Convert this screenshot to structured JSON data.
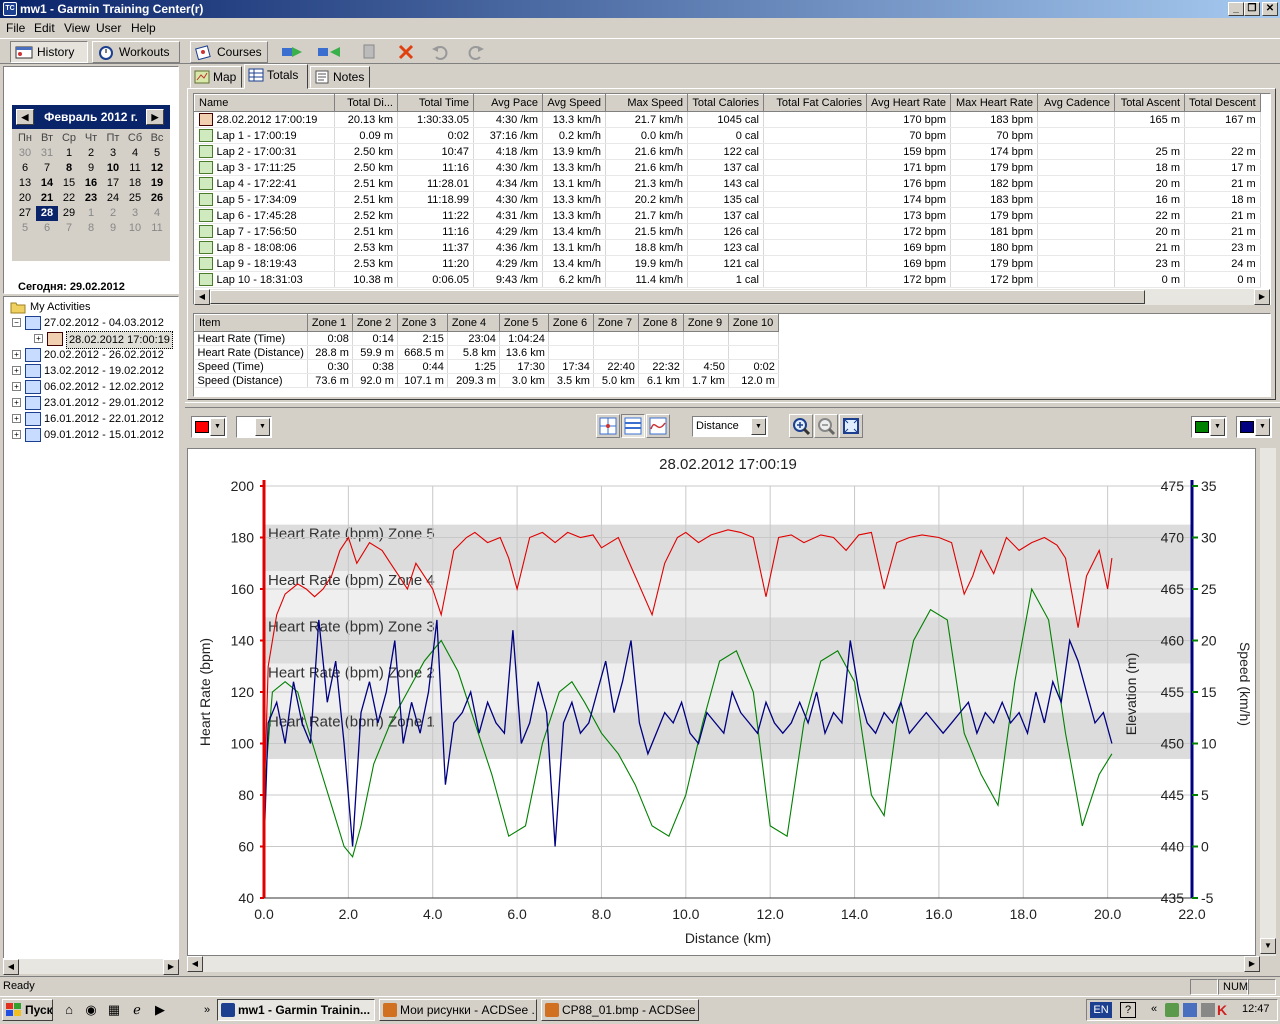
{
  "window": {
    "title": "mw1 - Garmin Training Center(r)",
    "btn_min": "_",
    "btn_max": "❐",
    "btn_close": "✕"
  },
  "menu": [
    "File",
    "Edit",
    "View",
    "User",
    "Help"
  ],
  "toolbar": {
    "history": "History",
    "workouts": "Workouts",
    "courses": "Courses"
  },
  "calendar": {
    "month": "Февраль 2012 г.",
    "prev": "◀",
    "next": "▶",
    "dow": [
      "Пн",
      "Вт",
      "Ср",
      "Чт",
      "Пт",
      "Сб",
      "Вс"
    ],
    "weeks": [
      [
        "30",
        "31",
        "1",
        "2",
        "3",
        "4",
        "5"
      ],
      [
        "6",
        "7",
        "8",
        "9",
        "10",
        "11",
        "12"
      ],
      [
        "13",
        "14",
        "15",
        "16",
        "17",
        "18",
        "19"
      ],
      [
        "20",
        "21",
        "22",
        "23",
        "24",
        "25",
        "26"
      ],
      [
        "27",
        "28",
        "29",
        "1",
        "2",
        "3",
        "4"
      ],
      [
        "5",
        "6",
        "7",
        "8",
        "9",
        "10",
        "11"
      ]
    ],
    "bold_days": [
      "8",
      "10",
      "12",
      "14",
      "16",
      "19",
      "21",
      "23",
      "26",
      "28"
    ],
    "selected_day": "28",
    "today": "Сегодня: 29.02.2012"
  },
  "tree": {
    "root": "My Activities",
    "items": [
      {
        "label": "27.02.2012 - 04.03.2012",
        "expanded": true
      },
      {
        "label": "28.02.2012 17:00:19",
        "child": true,
        "selected": true
      },
      {
        "label": "20.02.2012 - 26.02.2012"
      },
      {
        "label": "13.02.2012 - 19.02.2012"
      },
      {
        "label": "06.02.2012 - 12.02.2012"
      },
      {
        "label": "23.01.2012 - 29.01.2012"
      },
      {
        "label": "16.01.2012 - 22.01.2012"
      },
      {
        "label": "09.01.2012 - 15.01.2012"
      }
    ]
  },
  "tabs": {
    "map": "Map",
    "totals": "Totals",
    "notes": "Notes"
  },
  "laps": {
    "columns": [
      "Name",
      "Total Di...",
      "Total Time",
      "Avg Pace",
      "Avg Speed",
      "Max Speed",
      "Total Calories",
      "Total Fat Calories",
      "Avg Heart Rate",
      "Max Heart Rate",
      "Avg Cadence",
      "Total Ascent",
      "Total Descent"
    ],
    "rows": [
      [
        "28.02.2012 17:00:19",
        "20.13 km",
        "1:30:33.05",
        "4:30 /km",
        "13.3 km/h",
        "21.7 km/h",
        "1045 cal",
        "",
        "170 bpm",
        "183 bpm",
        "",
        "165 m",
        "167 m"
      ],
      [
        "Lap 1 - 17:00:19",
        "0.09 m",
        "0:02",
        "37:16 /km",
        "0.2 km/h",
        "0.0 km/h",
        "0 cal",
        "",
        "70 bpm",
        "70 bpm",
        "",
        "",
        ""
      ],
      [
        "Lap 2 - 17:00:31",
        "2.50 km",
        "10:47",
        "4:18 /km",
        "13.9 km/h",
        "21.6 km/h",
        "122 cal",
        "",
        "159 bpm",
        "174 bpm",
        "",
        "25 m",
        "22 m"
      ],
      [
        "Lap 3 - 17:11:25",
        "2.50 km",
        "11:16",
        "4:30 /km",
        "13.3 km/h",
        "21.6 km/h",
        "137 cal",
        "",
        "171 bpm",
        "179 bpm",
        "",
        "18 m",
        "17 m"
      ],
      [
        "Lap 4 - 17:22:41",
        "2.51 km",
        "11:28.01",
        "4:34 /km",
        "13.1 km/h",
        "21.3 km/h",
        "143 cal",
        "",
        "176 bpm",
        "182 bpm",
        "",
        "20 m",
        "21 m"
      ],
      [
        "Lap 5 - 17:34:09",
        "2.51 km",
        "11:18.99",
        "4:30 /km",
        "13.3 km/h",
        "20.2 km/h",
        "135 cal",
        "",
        "174 bpm",
        "183 bpm",
        "",
        "16 m",
        "18 m"
      ],
      [
        "Lap 6 - 17:45:28",
        "2.52 km",
        "11:22",
        "4:31 /km",
        "13.3 km/h",
        "21.7 km/h",
        "137 cal",
        "",
        "173 bpm",
        "179 bpm",
        "",
        "22 m",
        "21 m"
      ],
      [
        "Lap 7 - 17:56:50",
        "2.51 km",
        "11:16",
        "4:29 /km",
        "13.4 km/h",
        "21.5 km/h",
        "126 cal",
        "",
        "172 bpm",
        "181 bpm",
        "",
        "20 m",
        "21 m"
      ],
      [
        "Lap 8 - 18:08:06",
        "2.53 km",
        "11:37",
        "4:36 /km",
        "13.1 km/h",
        "18.8 km/h",
        "123 cal",
        "",
        "169 bpm",
        "180 bpm",
        "",
        "21 m",
        "23 m"
      ],
      [
        "Lap 9 - 18:19:43",
        "2.53 km",
        "11:20",
        "4:29 /km",
        "13.4 km/h",
        "19.9 km/h",
        "121 cal",
        "",
        "169 bpm",
        "179 bpm",
        "",
        "23 m",
        "24 m"
      ],
      [
        "Lap 10 - 18:31:03",
        "10.38 m",
        "0:06.05",
        "9:43 /km",
        "6.2 km/h",
        "11.4 km/h",
        "1 cal",
        "",
        "172 bpm",
        "172 bpm",
        "",
        "0 m",
        "0 m"
      ]
    ]
  },
  "zones": {
    "columns": [
      "Item",
      "Zone 1",
      "Zone 2",
      "Zone 3",
      "Zone 4",
      "Zone 5",
      "Zone 6",
      "Zone 7",
      "Zone 8",
      "Zone 9",
      "Zone 10"
    ],
    "rows": [
      [
        "Heart Rate (Time)",
        "0:08",
        "0:14",
        "2:15",
        "23:04",
        "1:04:24",
        "",
        "",
        "",
        "",
        ""
      ],
      [
        "Heart Rate (Distance)",
        "28.8 m",
        "59.9 m",
        "668.5 m",
        "5.8 km",
        "13.6 km",
        "",
        "",
        "",
        "",
        ""
      ],
      [
        "Speed (Time)",
        "0:30",
        "0:38",
        "0:44",
        "1:25",
        "17:30",
        "17:34",
        "22:40",
        "22:32",
        "4:50",
        "0:02"
      ],
      [
        "Speed (Distance)",
        "73.6 m",
        "92.0 m",
        "107.1 m",
        "209.3 m",
        "3.0 km",
        "3.5 km",
        "5.0 km",
        "6.1 km",
        "1.7 km",
        "12.0 m"
      ]
    ]
  },
  "chart_controls": {
    "x_axis_select": "Distance",
    "left_color": "#ff0000",
    "right_color1": "#008000",
    "right_color2": "#000080"
  },
  "chart_data": {
    "type": "line",
    "title": "28.02.2012 17:00:19",
    "xlabel": "Distance (km)",
    "xlim": [
      0,
      22
    ],
    "xticks": [
      "0.0",
      "2.0",
      "4.0",
      "6.0",
      "8.0",
      "10.0",
      "12.0",
      "14.0",
      "16.0",
      "18.0",
      "20.0",
      "22.0"
    ],
    "y_left": {
      "label": "Heart Rate (bpm)",
      "ylim": [
        40,
        200
      ],
      "ticks": [
        "200",
        "180",
        "160",
        "140",
        "120",
        "100",
        "80",
        "60",
        "40"
      ],
      "color": "#e00000"
    },
    "y_elev": {
      "label": "Elevation (m)",
      "ylim": [
        435,
        475
      ],
      "ticks": [
        "475",
        "470",
        "465",
        "460",
        "455",
        "450",
        "445",
        "440",
        "435"
      ],
      "color": "#008000"
    },
    "y_speed": {
      "label": "Speed (km/h)",
      "ylim": [
        -5,
        35
      ],
      "ticks": [
        "35",
        "30",
        "25",
        "20",
        "15",
        "10",
        "5",
        "0",
        "-5"
      ],
      "color": "#000080"
    },
    "zones": [
      {
        "name": "Heart Rate (bpm) Zone 5",
        "from": 167,
        "to": 185
      },
      {
        "name": "Heart Rate (bpm) Zone 4",
        "from": 149,
        "to": 167
      },
      {
        "name": "Heart Rate (bpm) Zone 3",
        "from": 131,
        "to": 149
      },
      {
        "name": "Heart Rate (bpm) Zone 2",
        "from": 112,
        "to": 131
      },
      {
        "name": "Heart Rate (bpm) Zone 1",
        "from": 94,
        "to": 112
      }
    ],
    "series": [
      {
        "name": "Heart Rate",
        "color": "#e00000",
        "x": [
          0.0,
          0.1,
          0.3,
          0.5,
          0.8,
          1.0,
          1.2,
          1.4,
          1.6,
          1.8,
          2.0,
          2.2,
          2.5,
          2.8,
          3.0,
          3.2,
          3.4,
          3.6,
          3.8,
          4.0,
          4.2,
          4.5,
          4.8,
          5.0,
          5.3,
          5.6,
          5.8,
          6.0,
          6.3,
          6.6,
          6.9,
          7.2,
          7.5,
          7.8,
          8.0,
          8.4,
          8.8,
          9.2,
          9.5,
          9.8,
          10.0,
          10.3,
          10.6,
          11.0,
          11.3,
          11.6,
          11.9,
          12.2,
          12.5,
          12.8,
          13.2,
          13.5,
          13.8,
          14.1,
          14.4,
          14.7,
          15.0,
          15.3,
          15.6,
          16.0,
          16.3,
          16.6,
          16.8,
          17.0,
          17.3,
          17.6,
          17.9,
          18.2,
          18.5,
          18.8,
          19.0,
          19.3,
          19.5,
          19.8,
          20.0,
          20.1
        ],
        "y": [
          75,
          130,
          150,
          158,
          162,
          160,
          157,
          160,
          165,
          175,
          180,
          170,
          178,
          175,
          170,
          165,
          160,
          170,
          165,
          160,
          150,
          175,
          180,
          182,
          178,
          180,
          172,
          160,
          180,
          182,
          178,
          182,
          180,
          181,
          176,
          180,
          165,
          150,
          170,
          180,
          182,
          178,
          181,
          183,
          182,
          180,
          157,
          180,
          181,
          178,
          181,
          180,
          175,
          181,
          182,
          160,
          178,
          180,
          181,
          180,
          178,
          158,
          165,
          175,
          166,
          180,
          175,
          178,
          180,
          177,
          172,
          145,
          165,
          175,
          160,
          172
        ]
      },
      {
        "name": "Elevation",
        "color": "#008000",
        "x": [
          0.0,
          0.2,
          0.5,
          0.8,
          1.0,
          1.3,
          1.6,
          1.9,
          2.1,
          2.3,
          2.6,
          3.0,
          3.4,
          3.8,
          4.2,
          4.6,
          5.0,
          5.4,
          5.8,
          6.2,
          6.6,
          7.0,
          7.3,
          7.6,
          8.0,
          8.4,
          8.8,
          9.2,
          9.6,
          10.0,
          10.4,
          10.8,
          11.2,
          11.6,
          12.0,
          12.4,
          12.8,
          13.2,
          13.6,
          14.0,
          14.4,
          14.7,
          15.0,
          15.4,
          15.8,
          16.2,
          16.6,
          17.0,
          17.4,
          17.8,
          18.2,
          18.6,
          19.0,
          19.4,
          19.8,
          20.1
        ],
        "y": [
          445,
          455,
          456,
          455,
          452,
          448,
          444,
          440,
          439,
          442,
          448,
          452,
          455,
          458,
          460,
          457,
          452,
          447,
          441,
          442,
          450,
          455,
          456,
          454,
          451,
          449,
          446,
          442,
          441,
          445,
          452,
          458,
          459,
          455,
          442,
          441,
          452,
          458,
          459,
          456,
          445,
          443,
          452,
          460,
          463,
          462,
          451,
          447,
          444,
          456,
          465,
          462,
          451,
          442,
          447,
          449
        ]
      },
      {
        "name": "Speed",
        "color": "#000080",
        "x": [
          0.0,
          0.1,
          0.3,
          0.5,
          0.7,
          0.9,
          1.1,
          1.3,
          1.5,
          1.7,
          1.9,
          2.1,
          2.3,
          2.5,
          2.7,
          2.9,
          3.1,
          3.3,
          3.5,
          3.7,
          3.9,
          4.1,
          4.3,
          4.5,
          4.7,
          4.9,
          5.1,
          5.3,
          5.5,
          5.7,
          5.9,
          6.1,
          6.3,
          6.5,
          6.7,
          6.9,
          7.1,
          7.3,
          7.5,
          7.7,
          7.9,
          8.1,
          8.3,
          8.5,
          8.7,
          8.9,
          9.1,
          9.3,
          9.5,
          9.7,
          9.9,
          10.1,
          10.3,
          10.5,
          10.7,
          10.9,
          11.1,
          11.3,
          11.5,
          11.7,
          11.9,
          12.1,
          12.3,
          12.5,
          12.7,
          12.9,
          13.1,
          13.3,
          13.5,
          13.7,
          13.9,
          14.1,
          14.3,
          14.5,
          14.7,
          14.9,
          15.1,
          15.3,
          15.5,
          15.7,
          15.9,
          16.1,
          16.3,
          16.5,
          16.7,
          16.9,
          17.1,
          17.3,
          17.5,
          17.7,
          17.9,
          18.1,
          18.3,
          18.5,
          18.7,
          18.9,
          19.1,
          19.3,
          19.5,
          19.7,
          19.9,
          20.1
        ],
        "y": [
          0,
          12,
          14,
          10,
          16,
          12,
          10,
          22,
          14,
          18,
          10,
          0,
          13,
          16,
          12,
          15,
          20,
          10,
          14,
          11,
          15,
          22,
          6,
          12,
          13,
          15,
          11,
          14,
          12,
          11,
          21,
          10,
          12,
          16,
          13,
          0,
          12,
          14,
          11,
          12,
          15,
          18,
          13,
          16,
          20,
          12,
          9,
          11,
          13,
          12,
          14,
          11,
          10,
          13,
          12,
          11,
          15,
          13,
          12,
          11,
          14,
          12,
          11,
          12,
          14,
          12,
          15,
          11,
          13,
          12,
          20,
          15,
          12,
          11,
          13,
          12,
          14,
          11,
          12,
          13,
          12,
          11,
          12,
          13,
          14,
          11,
          13,
          12,
          14,
          12,
          13,
          11,
          15,
          12,
          16,
          14,
          20,
          18,
          15,
          12,
          13,
          10
        ]
      }
    ]
  },
  "status": {
    "text": "Ready",
    "num": "NUM"
  },
  "taskbar": {
    "start": "Пуск",
    "items": [
      "mw1 - Garmin Trainin...",
      "Мои рисунки - ACDSee ...",
      "CP88_01.bmp - ACDSee ..."
    ],
    "lang": "EN",
    "clock": "12:47",
    "chevron": "»"
  }
}
